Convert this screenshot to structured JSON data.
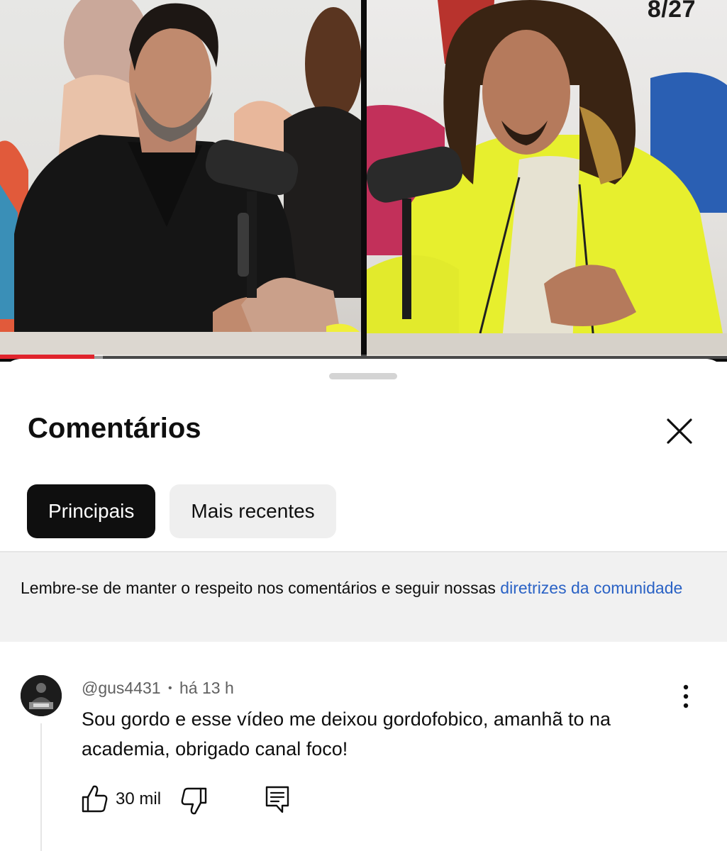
{
  "video": {
    "page_counter": "8/27",
    "progress": 0.13
  },
  "comments_sheet": {
    "title": "Comentários",
    "close_icon": "close-icon",
    "filters": [
      {
        "label": "Principais",
        "selected": true
      },
      {
        "label": "Mais recentes",
        "selected": false
      }
    ],
    "notice": {
      "text": "Lembre-se de manter o respeito nos comentários e seguir nossas ",
      "link": "diretrizes da comunidade"
    }
  },
  "comment": {
    "author": "@gus4431",
    "separator": "•",
    "time": "há 13 h",
    "text": "Sou gordo e esse vídeo me deixou gordofobico, amanhã to na academia, obrigado canal foco!",
    "likes": "30 mil",
    "icons": {
      "like": "thumbs-up-icon",
      "dislike": "thumbs-down-icon",
      "reply": "reply-icon",
      "menu": "more-vertical-icon"
    }
  },
  "colors": {
    "accent_link": "#2a62c5",
    "progress_red": "#e0242c",
    "chip_active_bg": "#0f0f0f",
    "chip_inactive_bg": "#efefef",
    "notice_bg": "#f1f1f1"
  }
}
